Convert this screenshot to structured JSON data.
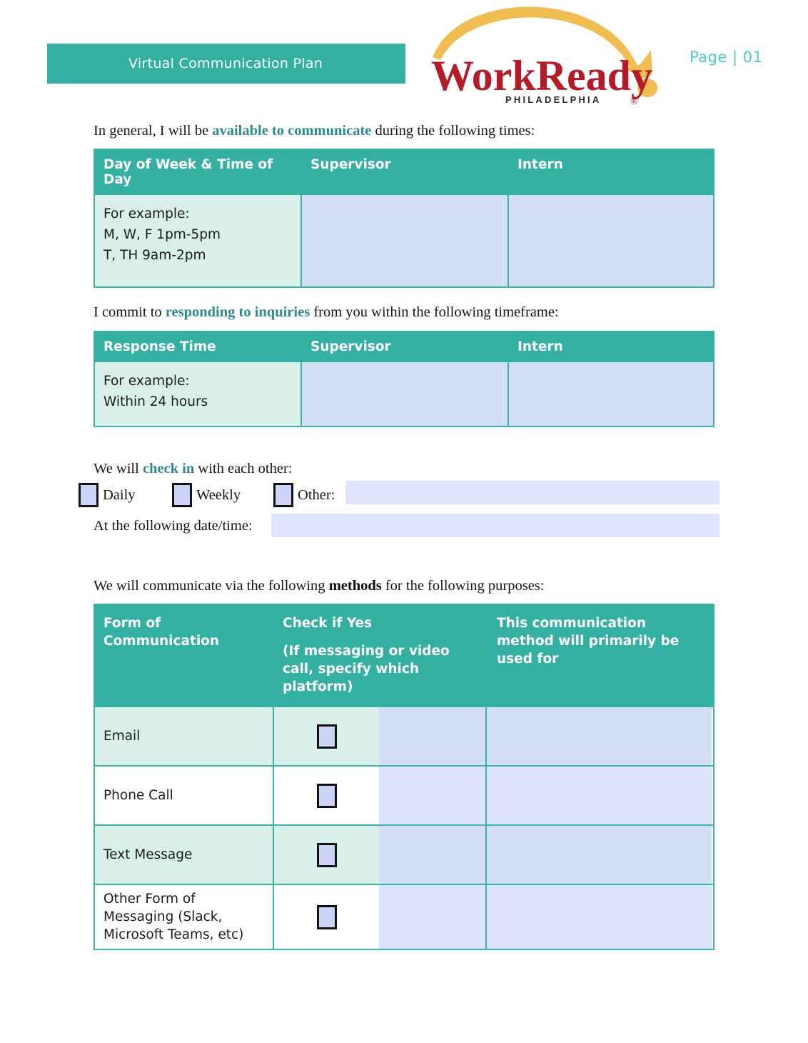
{
  "header": {
    "band_title": "Virtual Communication Plan",
    "page_label": "Page | 01",
    "band_color": "#34b0a3",
    "page_label_color": "#4fc7c4"
  },
  "logo": {
    "wordmark": "WorkReady",
    "subtitle": "PHILADELPHIA",
    "registered_mark": "®",
    "wordmark_color": "#b31b28",
    "arc_color": "#f0bd53"
  },
  "sections": {
    "availability": {
      "intro_before": "In general, I will be ",
      "intro_highlight": "available to communicate",
      "intro_after": " during the following times:",
      "headers": [
        "Day of Week & Time of Day",
        "Supervisor",
        "Intern"
      ],
      "example_lines": [
        "For example:",
        "M, W, F 1pm-5pm",
        "T, TH 9am-2pm"
      ],
      "supervisor_value": "",
      "intern_value": ""
    },
    "response": {
      "intro_before": "I commit to ",
      "intro_highlight": "responding to inquiries",
      "intro_after": " from you within the following timeframe:",
      "headers": [
        "Response Time",
        "Supervisor",
        "Intern"
      ],
      "example_lines": [
        "For example:",
        "Within 24 hours"
      ],
      "supervisor_value": "",
      "intern_value": ""
    },
    "checkin": {
      "intro_before": "We will ",
      "intro_highlight": "check in",
      "intro_after": " with each other:",
      "options": [
        {
          "label": "Daily",
          "checked": false
        },
        {
          "label": "Weekly",
          "checked": false
        },
        {
          "label": "Other:",
          "checked": false
        }
      ],
      "other_value": "",
      "datetime_label": "At the following date/time:",
      "datetime_value": ""
    },
    "methods": {
      "intro_before": "We will communicate via the following ",
      "intro_bold": "methods",
      "intro_after": " for the following purposes:",
      "headers": {
        "col1": "Form of Communication",
        "col2_main": "Check if Yes",
        "col2_sub": "(If messaging or video call, specify which platform)",
        "col3": "This communication method will primarily be used for"
      },
      "rows": [
        {
          "label": "Email",
          "checked": false,
          "platform": "",
          "purpose": ""
        },
        {
          "label": "Phone Call",
          "checked": false,
          "platform": "",
          "purpose": ""
        },
        {
          "label": "Text Message",
          "checked": false,
          "platform": "",
          "purpose": ""
        },
        {
          "label": "Other Form of Messaging (Slack, Microsoft Teams, etc)",
          "checked": false,
          "platform": "",
          "purpose": ""
        }
      ]
    }
  }
}
